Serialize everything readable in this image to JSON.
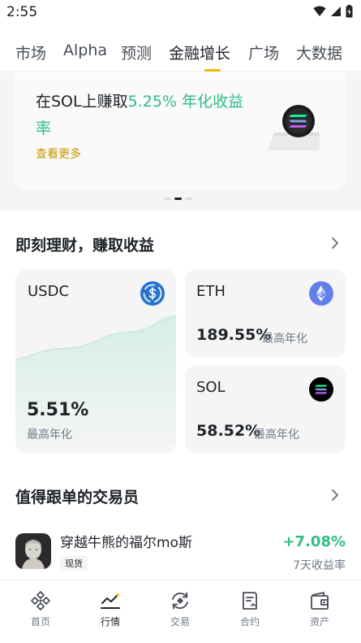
{
  "status_bar": {
    "time": "2:55"
  },
  "tabs": [
    {
      "label": "市场"
    },
    {
      "label": "Alpha"
    },
    {
      "label": "预测"
    },
    {
      "label": "金融增长",
      "active": true
    },
    {
      "label": "广场"
    },
    {
      "label": "大数据"
    }
  ],
  "banner": {
    "title_prefix": "在SOL上赚取",
    "title_highlight": "5.25% 年化收益率",
    "link": "查看更多",
    "carousel": {
      "total": 3,
      "current": 2
    }
  },
  "earn_section": {
    "title": "即刻理财，赚取收益",
    "cards": {
      "usdc": {
        "name": "USDC",
        "rate": "5.51%",
        "sub": "最高年化"
      },
      "eth": {
        "name": "ETH",
        "rate": "189.55%",
        "sub": "最高年化"
      },
      "sol": {
        "name": "SOL",
        "rate": "58.52%",
        "sub": "最高年化"
      }
    }
  },
  "traders_section": {
    "title": "值得跟单的交易员",
    "trader": {
      "name": "穿越牛熊的福尔mo斯",
      "tag": "现货",
      "pct": "+7.08%",
      "pct_label": "7天收益率"
    }
  },
  "bottom_nav": [
    {
      "label": "首页",
      "icon": "home-icon"
    },
    {
      "label": "行情",
      "icon": "markets-icon",
      "active": true
    },
    {
      "label": "交易",
      "icon": "trade-icon"
    },
    {
      "label": "合约",
      "icon": "futures-icon"
    },
    {
      "label": "资产",
      "icon": "wallet-icon"
    }
  ],
  "colors": {
    "accent": "#f0b90b",
    "positive": "#2ebd85",
    "link": "#c99400",
    "text": "#1e2329",
    "muted": "#707a8a"
  }
}
